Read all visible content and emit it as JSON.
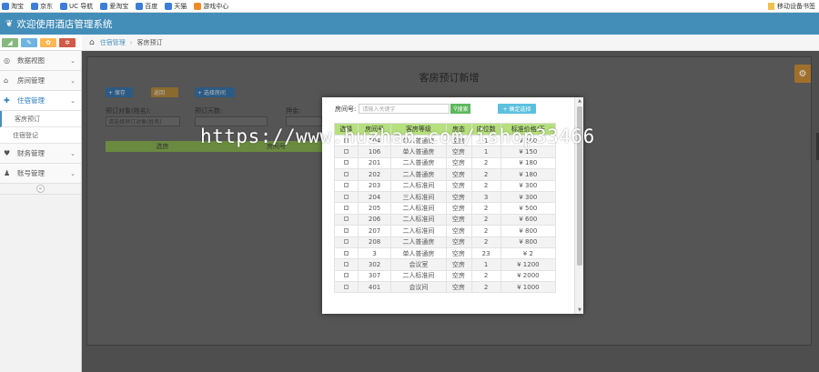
{
  "bookmarks": [
    {
      "label": "淘宝",
      "icon": "page-icon"
    },
    {
      "label": "京东",
      "icon": "page-icon"
    },
    {
      "label": "UC 导航",
      "icon": "page-icon"
    },
    {
      "label": "爱淘宝",
      "icon": "page-icon"
    },
    {
      "label": "百度",
      "icon": "page-icon"
    },
    {
      "label": "天猫",
      "icon": "page-icon"
    },
    {
      "label": "游戏中心",
      "icon": "game-icon"
    }
  ],
  "bookmarks_right": "移动设备书签",
  "header": {
    "title": "欢迎使用酒店管理系统"
  },
  "breadcrumb": {
    "parent": "住宿管理",
    "current": "客房预订"
  },
  "sidebar": {
    "items": [
      {
        "label": "数据视图",
        "icon": "dashboard-icon"
      },
      {
        "label": "房间管理",
        "icon": "home-icon"
      },
      {
        "label": "住宿管理",
        "icon": "move-icon",
        "active": true
      },
      {
        "label": "财务管理",
        "icon": "heart-icon"
      },
      {
        "label": "账号管理",
        "icon": "user-icon"
      }
    ],
    "sub_items": [
      {
        "label": "客房预订",
        "selected": true
      },
      {
        "label": "住宿登记",
        "selected": false
      }
    ]
  },
  "panel": {
    "title": "客房预订新增",
    "btn1": "+ 保存",
    "btn2": "返回",
    "btn3": "+ 选择房间",
    "label1": "预订对象(姓名):",
    "input1": "请选择预订对象(姓名)",
    "label2": "预订天数:",
    "label3": "押金:",
    "head1": "选房",
    "head2": "房间号"
  },
  "modal": {
    "search_label": "房间号:",
    "search_placeholder": "请输入关键字",
    "search_button": "搜索",
    "add_button": "+ 确定选择",
    "columns": [
      "选择",
      "房间号",
      "客房等级",
      "房态",
      "床位数",
      "标准价格/天"
    ],
    "rows": [
      [
        "104",
        "单人普通房",
        "空房",
        "1",
        "¥ 100"
      ],
      [
        "106",
        "单人普通房",
        "空房",
        "1",
        "¥ 150"
      ],
      [
        "201",
        "二人普通房",
        "空房",
        "2",
        "¥ 180"
      ],
      [
        "202",
        "二人普通房",
        "空房",
        "2",
        "¥ 180"
      ],
      [
        "203",
        "二人标准间",
        "空房",
        "2",
        "¥ 300"
      ],
      [
        "204",
        "三人标准间",
        "空房",
        "3",
        "¥ 300"
      ],
      [
        "205",
        "二人标准间",
        "空房",
        "2",
        "¥ 500"
      ],
      [
        "206",
        "二人标准间",
        "空房",
        "2",
        "¥ 600"
      ],
      [
        "207",
        "二人标准间",
        "空房",
        "2",
        "¥ 800"
      ],
      [
        "208",
        "二人普通房",
        "空房",
        "2",
        "¥ 800"
      ],
      [
        "3",
        "单人普通房",
        "空房",
        "23",
        "¥ 2"
      ],
      [
        "302",
        "会议室",
        "空房",
        "1",
        "¥ 1200"
      ],
      [
        "307",
        "二人标准间",
        "空房",
        "2",
        "¥ 2000"
      ],
      [
        "401",
        "会议间",
        "空房",
        "2",
        "¥ 1000"
      ]
    ]
  },
  "watermark": "https://www.huzhan.com/ishop33466"
}
